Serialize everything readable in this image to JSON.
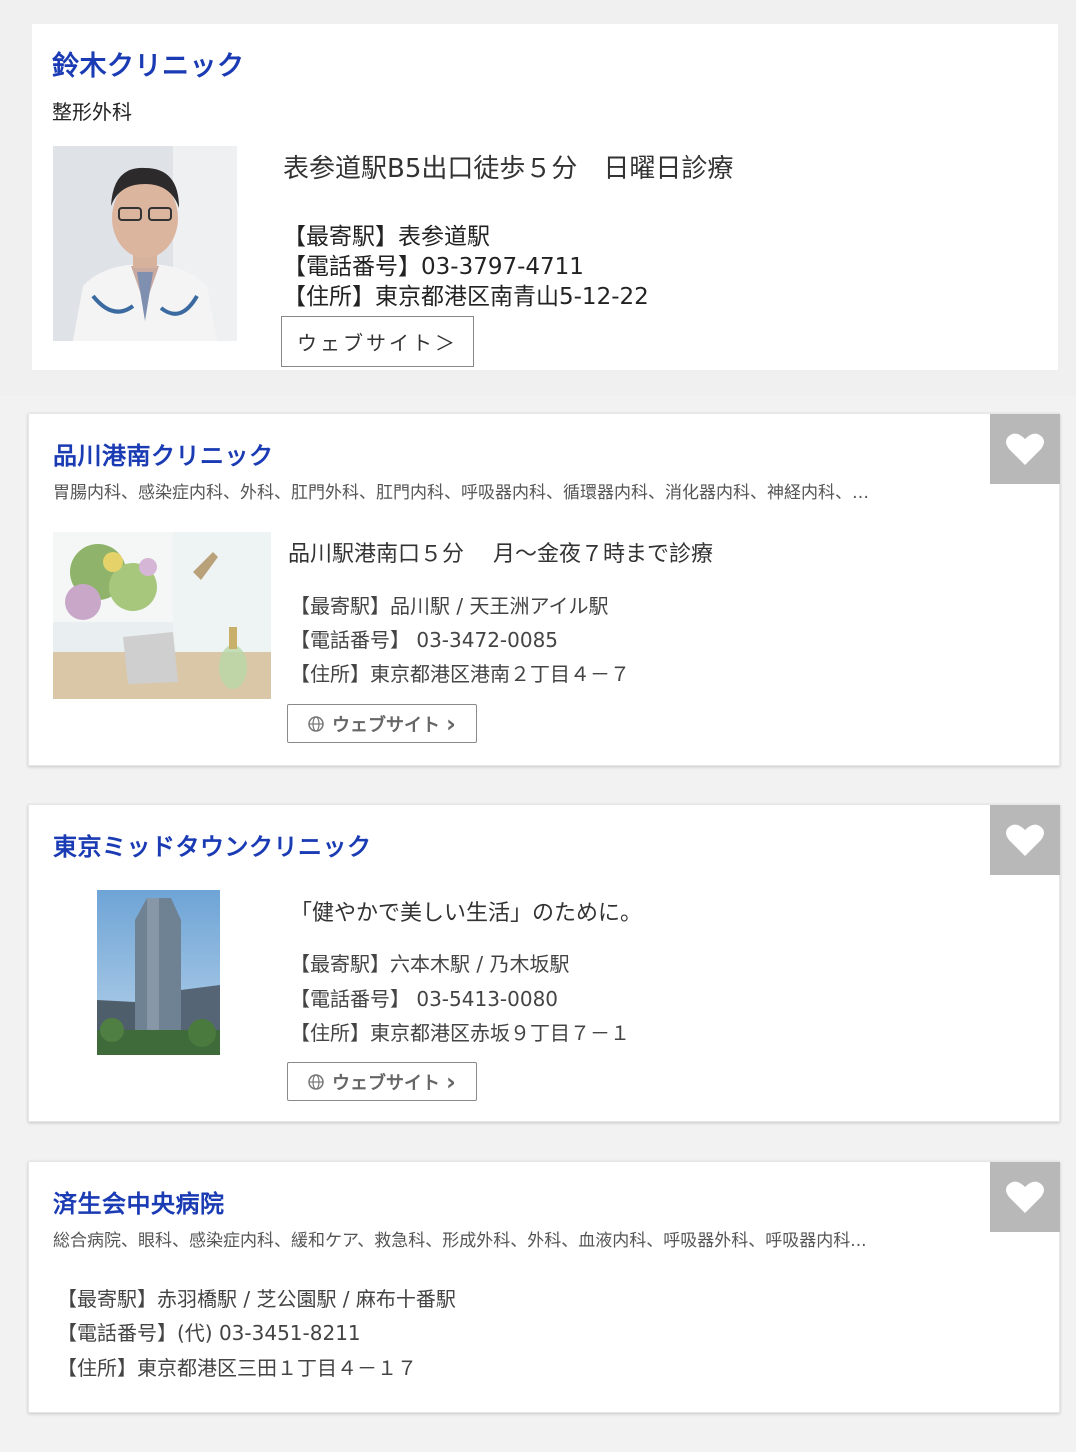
{
  "featured": {
    "name": "鈴木クリニック",
    "department": "整形外科",
    "tagline": "表参道駅B5出口徒歩５分　日曜日診療",
    "nearest_station": "【最寄駅】表参道駅",
    "phone": "【電話番号】03-3797-4711",
    "address": "【住所】東京都港区南青山5-12-22",
    "website_label": "ウェブサイト＞"
  },
  "clinics": [
    {
      "name": "品川港南クリニック",
      "departments": "胃腸内科、感染症内科、外科、肛門外科、肛門内科、呼吸器内科、循環器内科、消化器内科、神経内科、…",
      "tagline": "品川駅港南口５分　 月〜金夜７時まで診療",
      "nearest_station": "【最寄駅】品川駅 / 天王洲アイル駅",
      "phone": "【電話番号】 03-3472-0085",
      "address": "【住所】東京都港区港南２丁目４－７",
      "website_label": "ウェブサイト",
      "website_chevron": "›"
    },
    {
      "name": "東京ミッドタウンクリニック",
      "departments": "",
      "tagline": "「健やかで美しい生活」のために。",
      "nearest_station": "【最寄駅】六本木駅 / 乃木坂駅",
      "phone": "【電話番号】 03-5413-0080",
      "address": "【住所】東京都港区赤坂９丁目７－１",
      "website_label": "ウェブサイト",
      "website_chevron": "›"
    },
    {
      "name": "済生会中央病院",
      "departments": "総合病院、眼科、感染症内科、緩和ケア、救急科、形成外科、外科、血液内科、呼吸器外科、呼吸器内科...",
      "nearest_station": "【最寄駅】赤羽橋駅 / 芝公園駅 / 麻布十番駅",
      "phone": "【電話番号】(代) 03-3451-8211",
      "address": "【住所】東京都港区三田１丁目４－１７"
    }
  ],
  "colors": {
    "clinic_name": "#1a3bb3",
    "favorite_bg": "#b8b8b8",
    "page_bg": "#f2f2f2"
  },
  "icons": {
    "favorite": "heart-icon",
    "website": "globe-icon"
  }
}
